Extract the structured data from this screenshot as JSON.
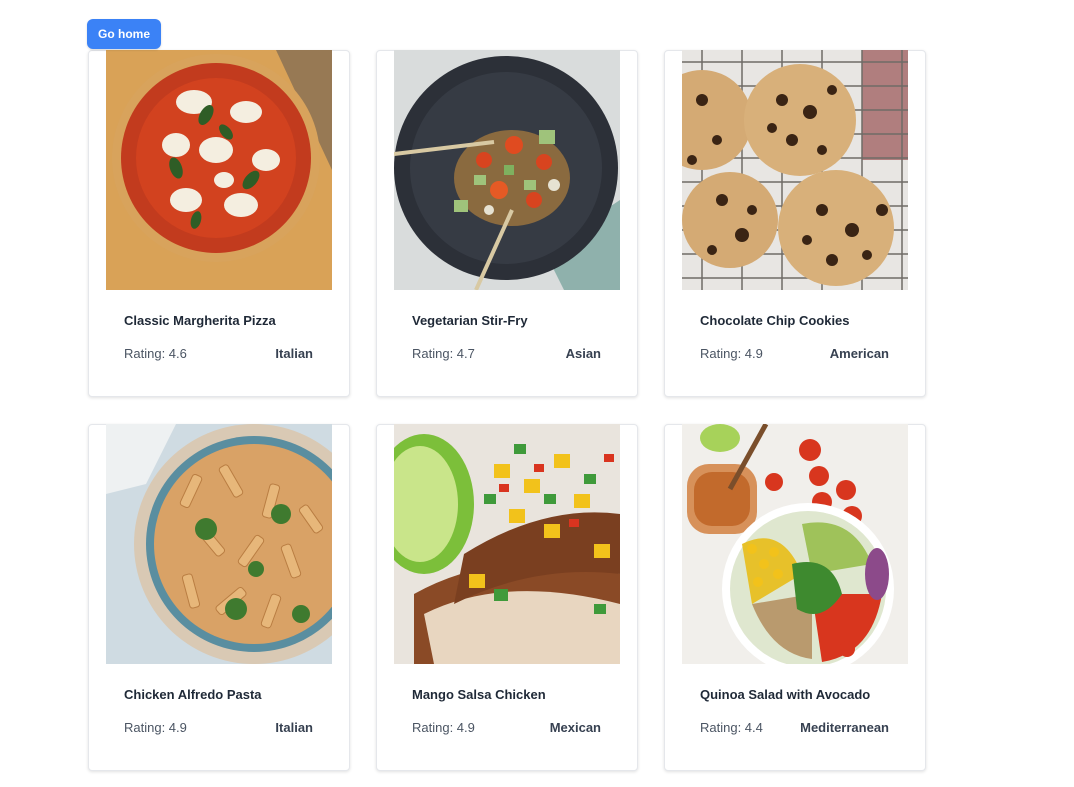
{
  "nav": {
    "go_home_label": "Go home"
  },
  "recipes": [
    {
      "name": "Classic Margherita Pizza",
      "rating": "Rating: 4.6",
      "cuisine": "Italian",
      "image": "margherita-pizza-photo"
    },
    {
      "name": "Vegetarian Stir-Fry",
      "rating": "Rating: 4.7",
      "cuisine": "Asian",
      "image": "stir-fry-bowl-photo"
    },
    {
      "name": "Chocolate Chip Cookies",
      "rating": "Rating: 4.9",
      "cuisine": "American",
      "image": "cookies-on-rack-photo"
    },
    {
      "name": "Chicken Alfredo Pasta",
      "rating": "Rating: 4.9",
      "cuisine": "Italian",
      "image": "penne-pasta-bowl-photo"
    },
    {
      "name": "Mango Salsa Chicken",
      "rating": "Rating: 4.9",
      "cuisine": "Mexican",
      "image": "grilled-chicken-salsa-photo"
    },
    {
      "name": "Quinoa Salad with Avocado",
      "rating": "Rating: 4.4",
      "cuisine": "Mediterranean",
      "image": "quinoa-salad-bowl-photo"
    }
  ],
  "colors": {
    "accent": "#3b82f6",
    "card_border": "#e5e7eb"
  }
}
